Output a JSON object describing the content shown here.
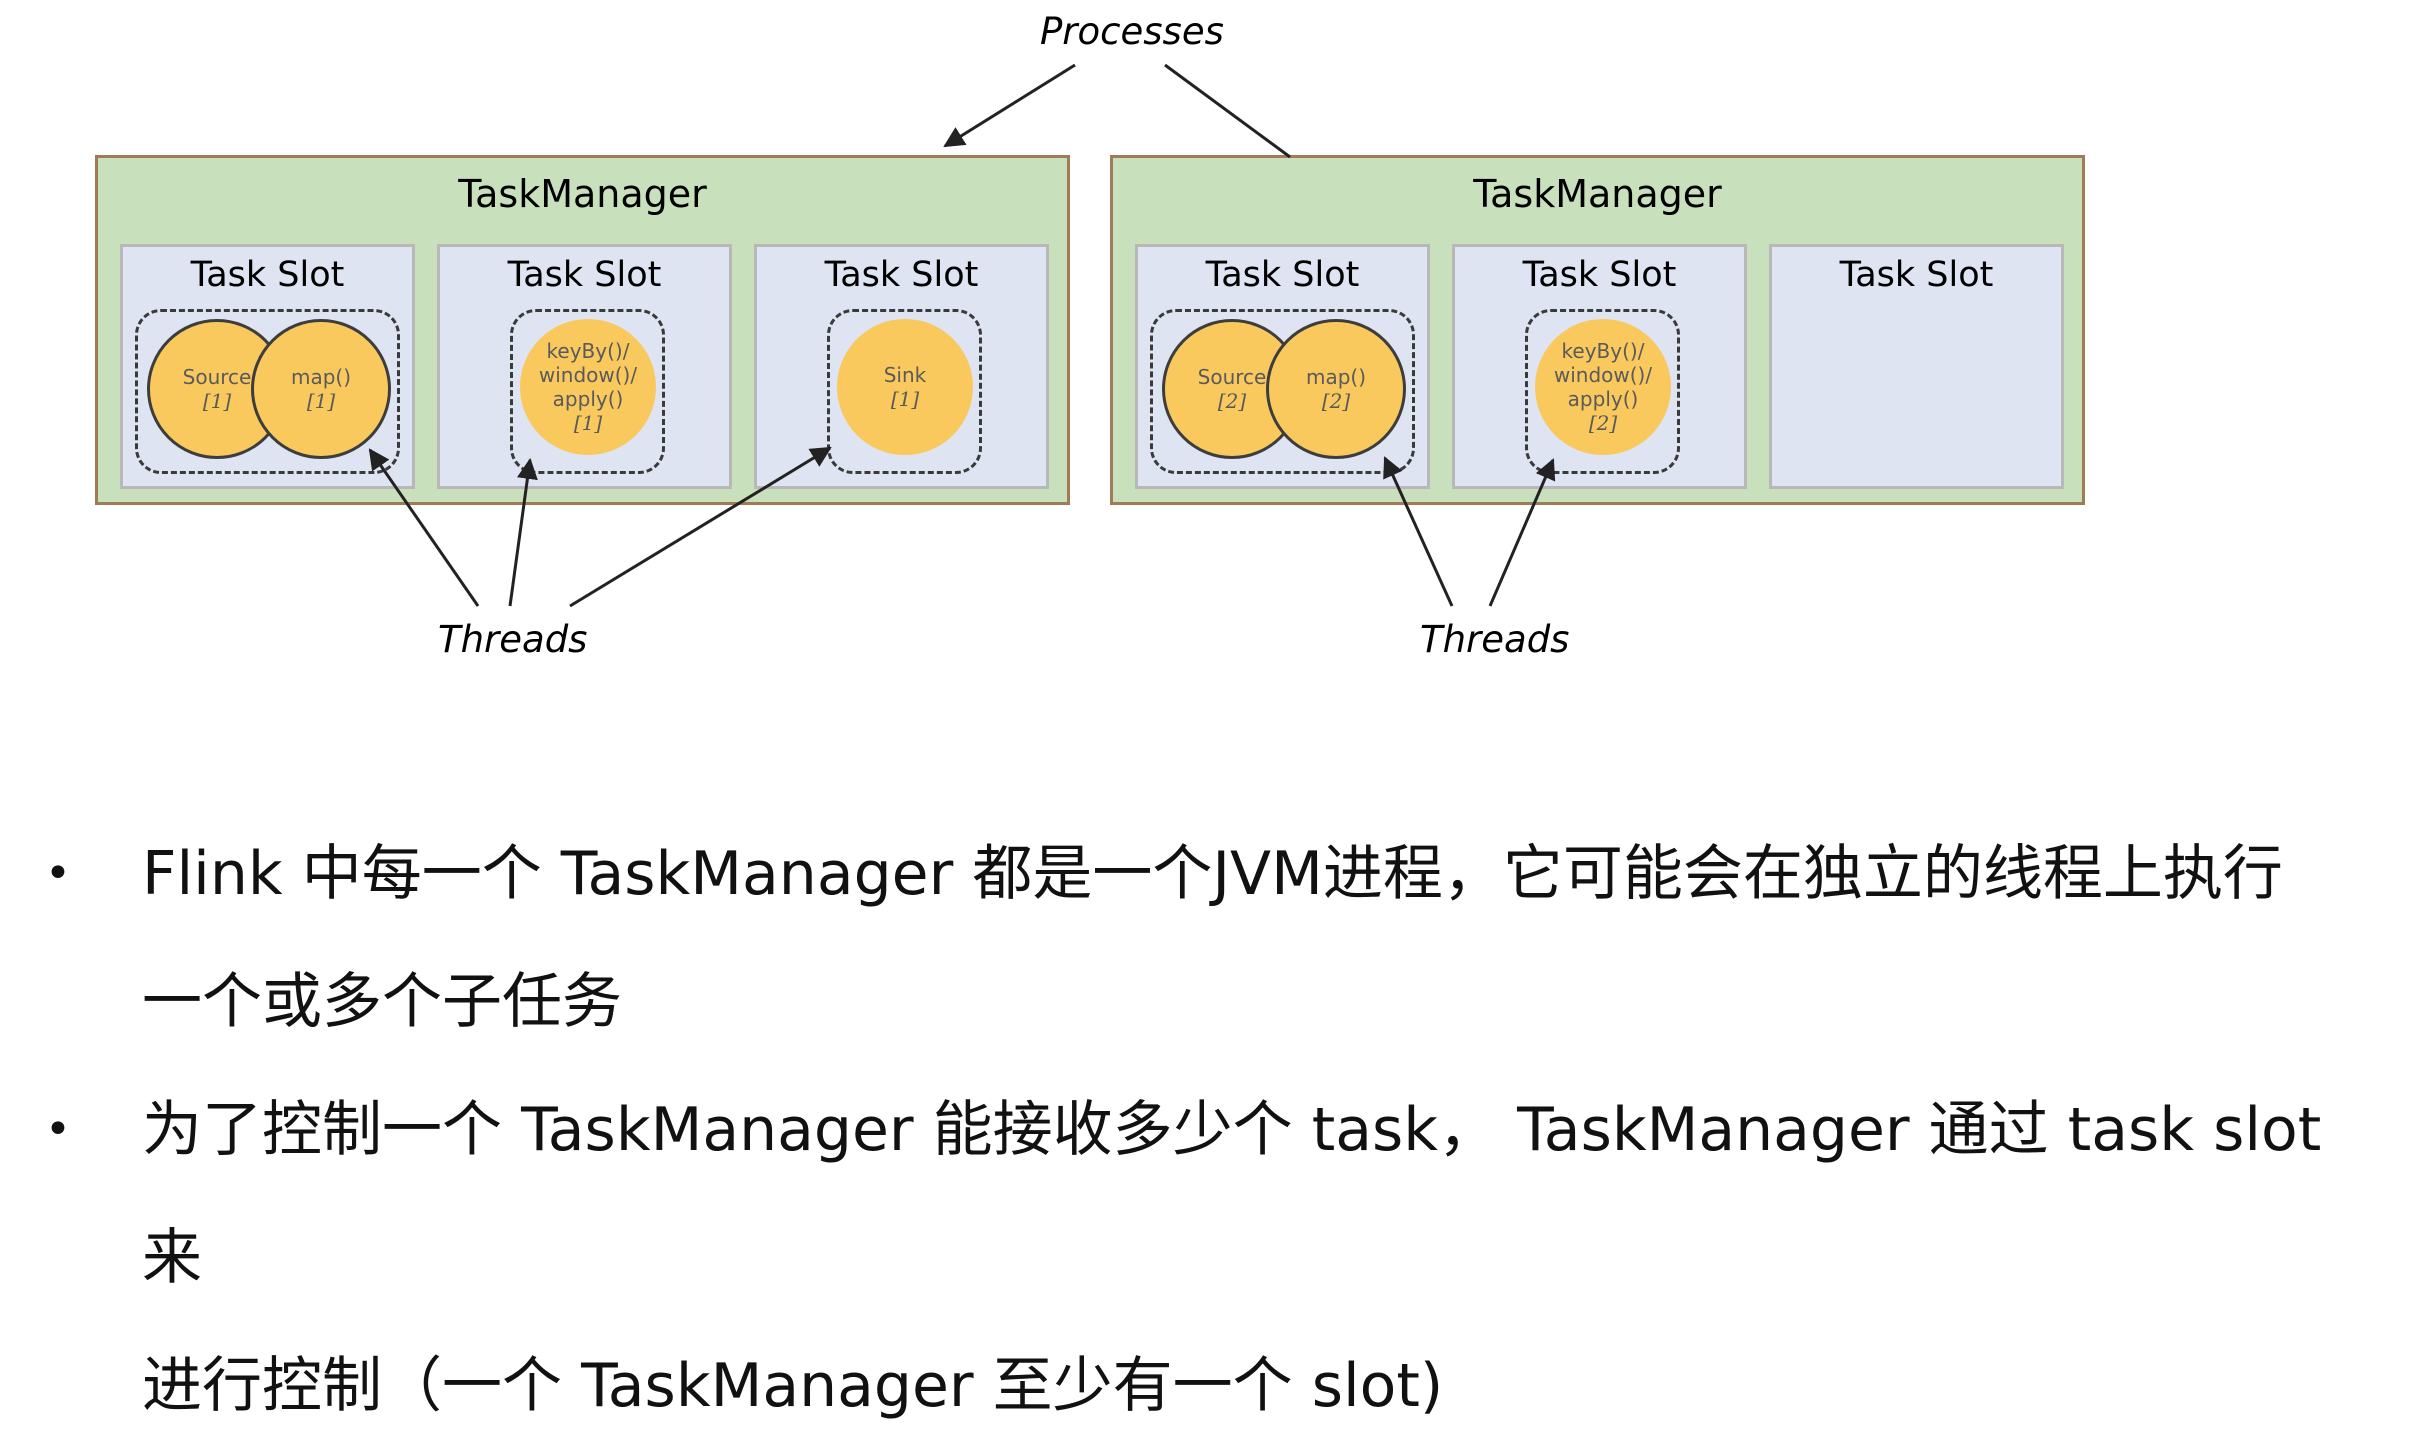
{
  "diagram": {
    "processes_label": "Processes",
    "threads_label": "Threads",
    "colors": {
      "taskmanager_fill": "#c9e0bd",
      "slot_fill": "#dee4f1",
      "operator_fill": "#f9c95e"
    },
    "taskmanagers": [
      {
        "title": "TaskManager",
        "slots": [
          {
            "title": "Task Slot",
            "operators": [
              {
                "name": "Source",
                "index": "[1]"
              },
              {
                "name": "map()",
                "index": "[1]"
              }
            ]
          },
          {
            "title": "Task Slot",
            "operators": [
              {
                "name": "keyBy()/\nwindow()/\napply()",
                "index": "[1]"
              }
            ]
          },
          {
            "title": "Task Slot",
            "operators": [
              {
                "name": "Sink",
                "index": "[1]"
              }
            ]
          }
        ]
      },
      {
        "title": "TaskManager",
        "slots": [
          {
            "title": "Task Slot",
            "operators": [
              {
                "name": "Source",
                "index": "[2]"
              },
              {
                "name": "map()",
                "index": "[2]"
              }
            ]
          },
          {
            "title": "Task Slot",
            "operators": [
              {
                "name": "keyBy()/\nwindow()/\napply()",
                "index": "[2]"
              }
            ]
          },
          {
            "title": "Task Slot",
            "operators": []
          }
        ]
      }
    ]
  },
  "bullets": [
    {
      "line1": "Flink 中每一个 TaskManager 都是一个JVM进程，它可能会在独立的线程上执行",
      "line2": "一个或多个子任务"
    },
    {
      "line1": "为了控制一个 TaskManager 能接收多少个 task， TaskManager 通过 task slot 来",
      "line2": "进行控制（一个 TaskManager 至少有一个 slot)"
    }
  ]
}
